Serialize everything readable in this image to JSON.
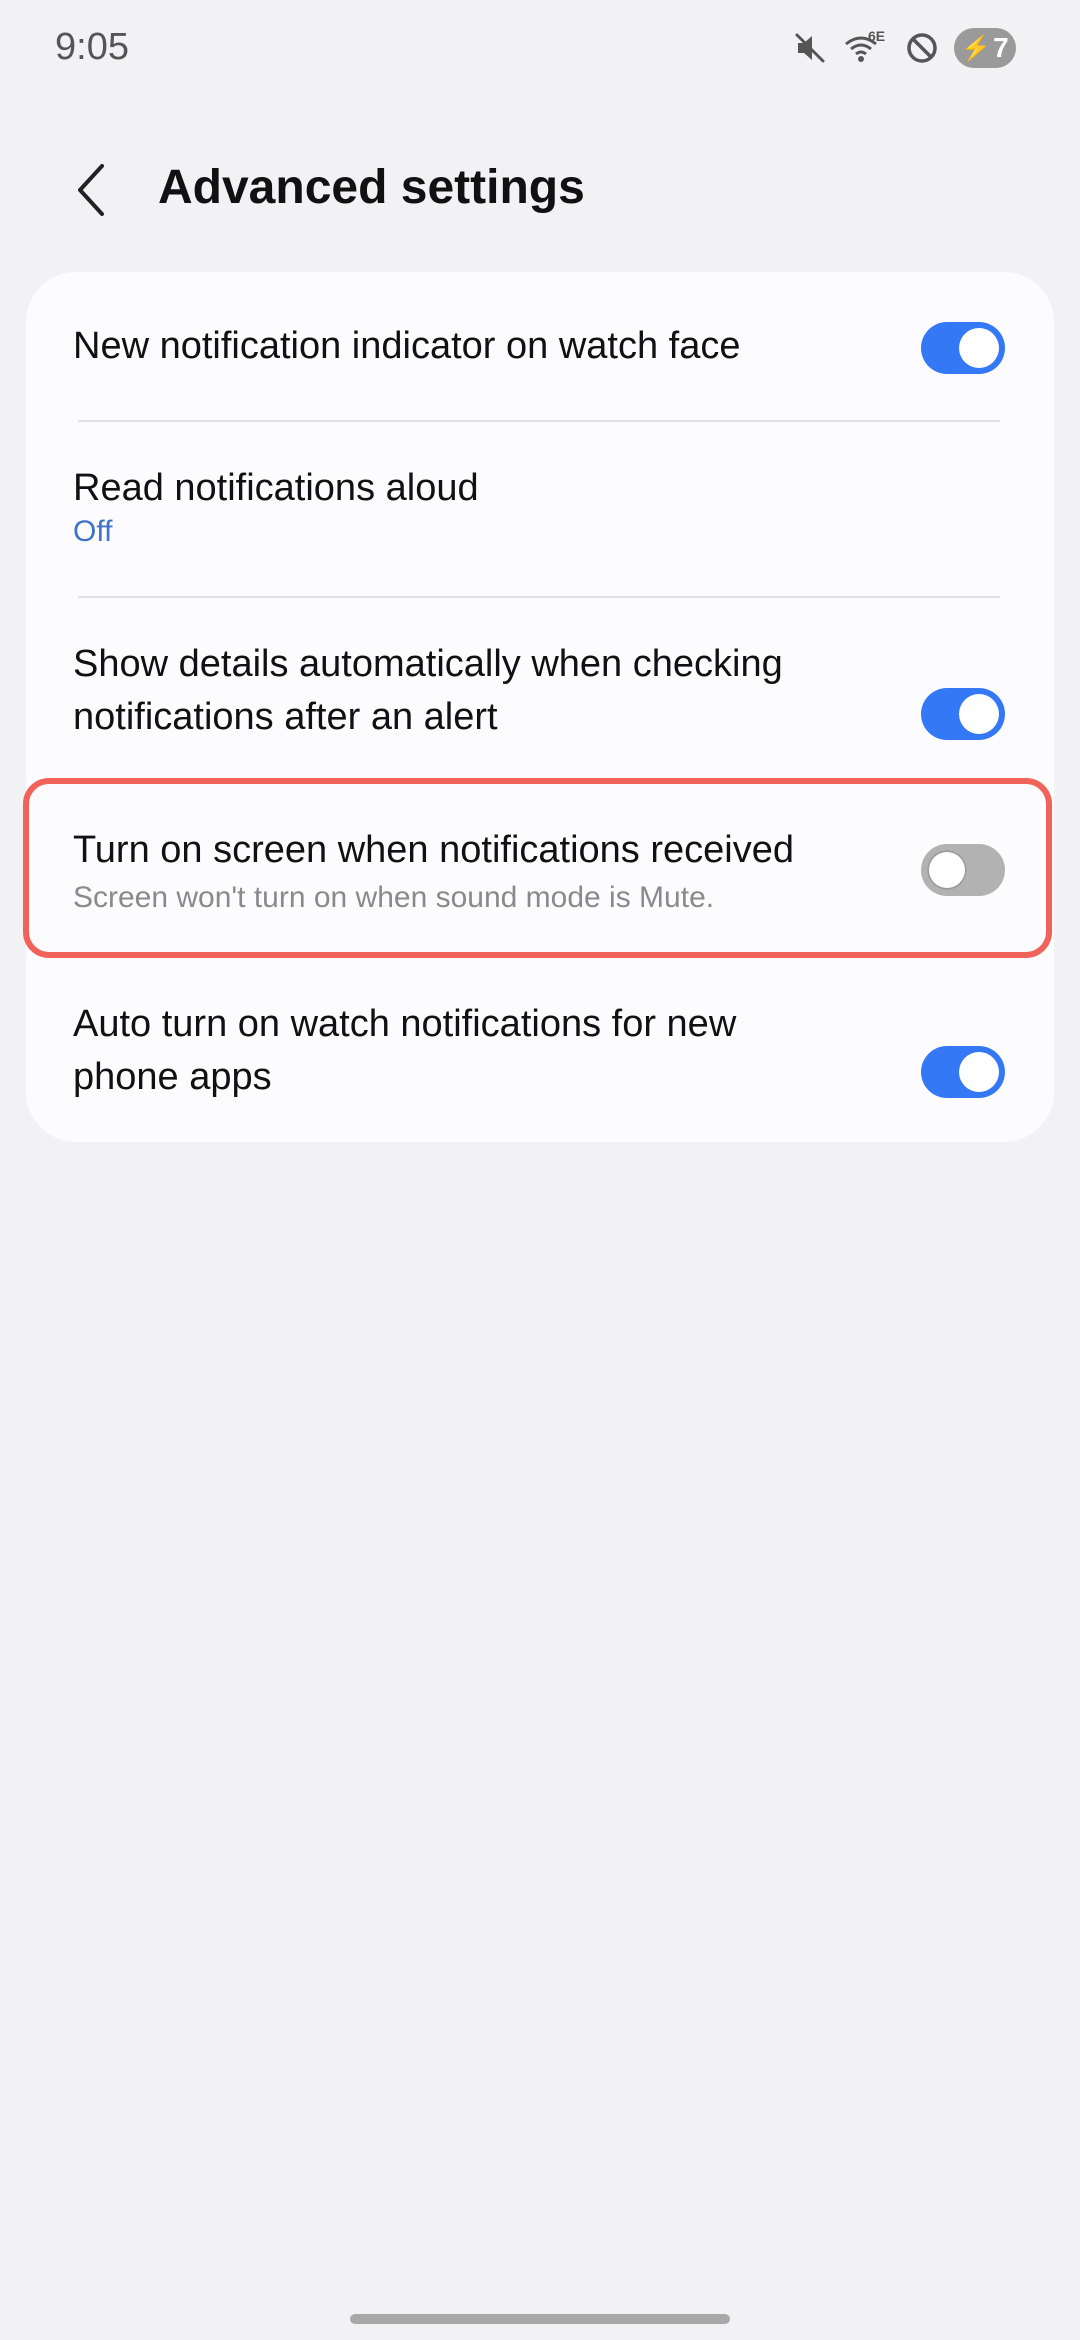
{
  "status_bar": {
    "time": "9:05",
    "network_label": "6E",
    "battery_level": "7",
    "icons": [
      "mute-icon",
      "wifi-6e-icon",
      "do-not-disturb-icon",
      "battery-charging-icon"
    ]
  },
  "header": {
    "back_icon": "chevron-left-icon",
    "title": "Advanced settings"
  },
  "settings": [
    {
      "title": "New notification indicator on watch face",
      "toggle": true
    },
    {
      "title": "Read notifications aloud",
      "subtitle": "Off"
    },
    {
      "title_line1": "Show details automatically when checking",
      "title_line2": "notifications after an alert",
      "toggle": true
    },
    {
      "title": "Turn on screen when notifications received",
      "subtitle": "Screen won't turn on when sound mode is Mute.",
      "toggle": false,
      "highlighted": true
    },
    {
      "title_line1": "Auto turn on watch notifications for new",
      "title_line2": "phone apps",
      "toggle": true
    }
  ],
  "colors": {
    "background": "#f2f2f4",
    "card": "#fcfcfe",
    "toggle_on": "#3478f6",
    "toggle_off": "#b2b2b2",
    "link_blue": "#3e73c9",
    "highlight_border": "#f0625a"
  }
}
